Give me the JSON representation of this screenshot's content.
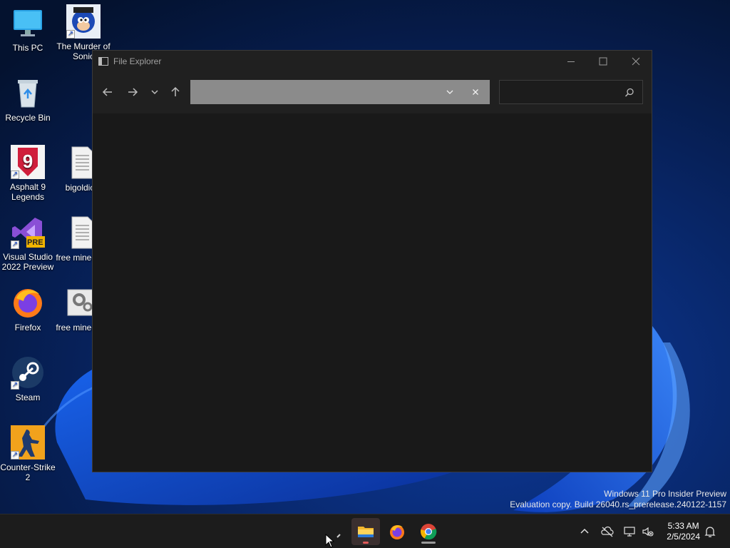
{
  "desktop": {
    "icons": [
      {
        "label": "This PC",
        "icon": "monitor-icon"
      },
      {
        "label": "The Murder of Sonic",
        "icon": "sonic-game-icon"
      },
      {
        "label": "Recycle Bin",
        "icon": "recycle-bin-icon"
      },
      {
        "label": "Asphalt 9 Legends",
        "icon": "asphalt-icon"
      },
      {
        "label": "bigoldick",
        "icon": "text-file-icon"
      },
      {
        "label": "Visual Studio 2022 Preview",
        "icon": "visual-studio-icon",
        "badge": "PRE"
      },
      {
        "label": "free minecraft",
        "icon": "text-file-icon"
      },
      {
        "label": "Firefox",
        "icon": "firefox-icon"
      },
      {
        "label": "free minecraft",
        "icon": "settings-file-icon"
      },
      {
        "label": "Steam",
        "icon": "steam-icon"
      },
      {
        "label": "Counter-Strike 2",
        "icon": "counter-strike-icon"
      }
    ]
  },
  "explorer": {
    "title": "File Explorer",
    "address_value": "",
    "search_placeholder": "",
    "controls": [
      "minimize-icon",
      "maximize-icon",
      "close-icon"
    ]
  },
  "watermark": {
    "line1": "Windows 11 Pro Insider Preview",
    "line2": "Evaluation copy. Build 26040.rs_prerelease.240122-1157"
  },
  "taskbar": {
    "apps": [
      "start-icon",
      "file-explorer-icon",
      "firefox-icon",
      "chrome-icon"
    ],
    "time": "5:33 AM",
    "date": "2/5/2024"
  },
  "colors": {
    "accent": "#0067c0",
    "window_bg": "#191919",
    "taskbar_bg": "#1c1c1c"
  }
}
